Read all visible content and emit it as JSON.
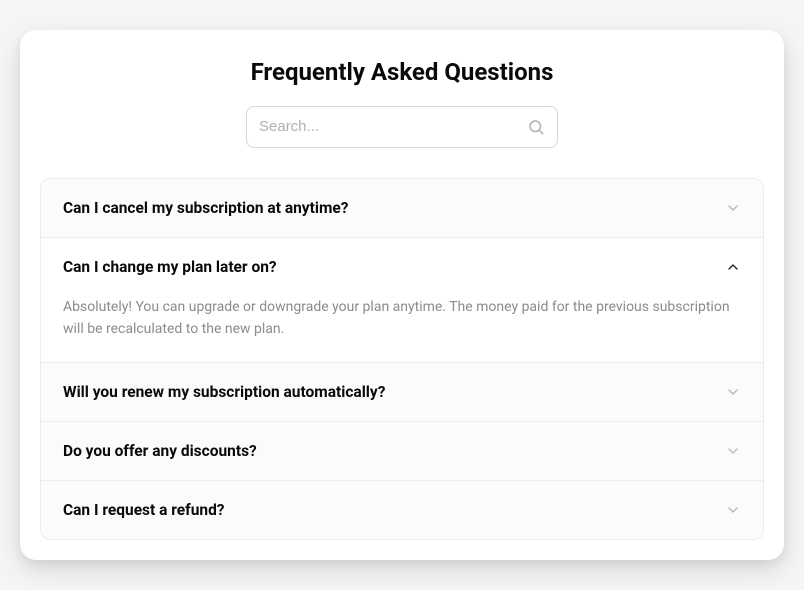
{
  "title": "Frequently Asked Questions",
  "search": {
    "placeholder": "Search..."
  },
  "faq": {
    "items": [
      {
        "question": "Can I cancel my subscription at anytime?",
        "expanded": false
      },
      {
        "question": "Can I change my plan later on?",
        "expanded": true,
        "answer": "Absolutely! You can upgrade or downgrade your plan anytime. The money paid for the previous subscription will be recalculated to the new plan."
      },
      {
        "question": "Will you renew my subscription automatically?",
        "expanded": false
      },
      {
        "question": "Do you offer any discounts?",
        "expanded": false
      },
      {
        "question": "Can I request a refund?",
        "expanded": false
      }
    ]
  }
}
